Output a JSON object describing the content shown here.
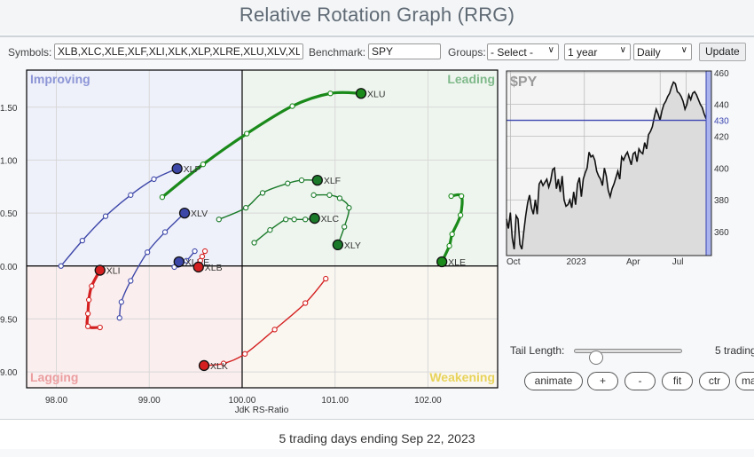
{
  "header": {
    "title": "Relative Rotation Graph (RRG)"
  },
  "toolbar": {
    "symbols_label": "Symbols:",
    "symbols_value": "XLB,XLC,XLE,XLF,XLI,XLK,XLP,XLRE,XLU,XLV,XLY",
    "benchmark_label": "Benchmark:",
    "benchmark_value": "SPY",
    "groups_label": "Groups:",
    "groups_value": "- Select -",
    "period_value": "1 year",
    "frequency_value": "Daily",
    "update_label": "Update"
  },
  "rrg": {
    "quadrants": {
      "improving": {
        "label": "Improving",
        "color": "#8d96d6",
        "bg": "#eef0fa"
      },
      "leading": {
        "label": "Leading",
        "color": "#7fb98a",
        "bg": "#eef5ee"
      },
      "lagging": {
        "label": "Lagging",
        "color": "#eb9ea0",
        "bg": "#fbeeee"
      },
      "weakening": {
        "label": "Weakening",
        "color": "#e8d35a",
        "bg": "#faf7f0"
      }
    },
    "xlabel": "JdK RS-Ratio",
    "x_ticks": [
      "98.00",
      "99.00",
      "100.00",
      "101.00",
      "102.00"
    ],
    "y_ticks_visible": [
      "1.50",
      "1.00",
      "0.50",
      "0.00",
      "9.50",
      "9.00"
    ]
  },
  "chart_data": {
    "type": "scatter",
    "title": "Relative Rotation Graph (RRG)",
    "xlabel": "JdK RS-Ratio",
    "ylabel": "JdK RS-Momentum",
    "xlim": [
      97.68,
      102.75
    ],
    "ylim": [
      98.85,
      101.85
    ],
    "center": [
      100,
      100
    ],
    "x_ticks": [
      98,
      99,
      100,
      101,
      102
    ],
    "y_ticks": [
      99.0,
      99.5,
      100.0,
      100.5,
      101.0,
      101.5
    ],
    "series": [
      {
        "name": "XLU",
        "color": "#1a8a1a",
        "quadrant": "Leading",
        "thick": true,
        "points": [
          [
            99.14,
            100.65
          ],
          [
            99.58,
            100.96
          ],
          [
            100.05,
            101.25
          ],
          [
            100.54,
            101.51
          ],
          [
            100.95,
            101.63
          ],
          [
            101.28,
            101.63
          ]
        ]
      },
      {
        "name": "XLP",
        "color": "#3d47a8",
        "quadrant": "Improving",
        "thick": false,
        "points": [
          [
            98.05,
            100.0
          ],
          [
            98.28,
            100.24
          ],
          [
            98.53,
            100.47
          ],
          [
            98.8,
            100.67
          ],
          [
            99.05,
            100.82
          ],
          [
            99.3,
            100.92
          ]
        ]
      },
      {
        "name": "XLV",
        "color": "#3d47a8",
        "quadrant": "Improving",
        "thick": false,
        "points": [
          [
            98.68,
            99.51
          ],
          [
            98.7,
            99.66
          ],
          [
            98.8,
            99.86
          ],
          [
            98.98,
            100.13
          ],
          [
            99.17,
            100.32
          ],
          [
            99.38,
            100.5
          ]
        ]
      },
      {
        "name": "XLRE",
        "color": "#3d47a8",
        "quadrant": "Improving",
        "thick": false,
        "points": [
          [
            99.49,
            100.14
          ],
          [
            99.4,
            100.05
          ],
          [
            99.31,
            100.01
          ],
          [
            99.27,
            99.99
          ],
          [
            99.32,
            100.04
          ]
        ]
      },
      {
        "name": "XLB",
        "color": "#d42020",
        "quadrant": "Lagging",
        "thick": false,
        "points": [
          [
            99.6,
            100.14
          ],
          [
            99.57,
            100.09
          ],
          [
            99.55,
            100.05
          ],
          [
            99.53,
            99.99
          ]
        ]
      },
      {
        "name": "XLI",
        "color": "#d42020",
        "quadrant": "Lagging",
        "thick": true,
        "points": [
          [
            98.47,
            99.42
          ],
          [
            98.34,
            99.43
          ],
          [
            98.34,
            99.55
          ],
          [
            98.35,
            99.68
          ],
          [
            98.38,
            99.81
          ],
          [
            98.47,
            99.96
          ]
        ]
      },
      {
        "name": "XLK",
        "color": "#d42020",
        "quadrant": "Lagging",
        "thick": false,
        "points": [
          [
            100.9,
            99.88
          ],
          [
            100.68,
            99.65
          ],
          [
            100.35,
            99.4
          ],
          [
            100.03,
            99.17
          ],
          [
            99.8,
            99.08
          ],
          [
            99.59,
            99.06
          ]
        ]
      },
      {
        "name": "XLF",
        "color": "#1a7a2a",
        "quadrant": "Leading",
        "thick": false,
        "points": [
          [
            99.75,
            100.44
          ],
          [
            100.04,
            100.55
          ],
          [
            100.22,
            100.69
          ],
          [
            100.49,
            100.78
          ],
          [
            100.64,
            100.81
          ],
          [
            100.81,
            100.81
          ]
        ]
      },
      {
        "name": "XLC",
        "color": "#1a7a2a",
        "quadrant": "Leading",
        "thick": false,
        "points": [
          [
            100.13,
            100.22
          ],
          [
            100.3,
            100.34
          ],
          [
            100.47,
            100.44
          ],
          [
            100.56,
            100.44
          ],
          [
            100.68,
            100.44
          ],
          [
            100.78,
            100.45
          ]
        ]
      },
      {
        "name": "XLY",
        "color": "#1a7a2a",
        "quadrant": "Leading",
        "thick": false,
        "points": [
          [
            100.77,
            100.67
          ],
          [
            100.94,
            100.67
          ],
          [
            101.05,
            100.64
          ],
          [
            101.15,
            100.55
          ],
          [
            101.1,
            100.37
          ],
          [
            101.03,
            100.2
          ]
        ]
      },
      {
        "name": "XLE",
        "color": "#1a8a1a",
        "quadrant": "Leading",
        "thick": true,
        "points": [
          [
            102.25,
            100.66
          ],
          [
            102.36,
            100.66
          ],
          [
            102.35,
            100.48
          ],
          [
            102.26,
            100.3
          ],
          [
            102.23,
            100.19
          ],
          [
            102.15,
            100.04
          ]
        ]
      }
    ]
  },
  "spy_chart": {
    "type": "line",
    "title": "$PY",
    "x_ticks": [
      "Oct",
      "2023",
      "Apr",
      "Jul"
    ],
    "y_ticks": [
      "460",
      "440",
      "430",
      "420",
      "400",
      "380",
      "360"
    ],
    "current_level": 430,
    "ylim": [
      345,
      461
    ],
    "values": [
      368,
      362,
      372,
      356,
      349,
      370,
      368,
      352,
      349,
      360,
      370,
      378,
      383,
      375,
      371,
      380,
      371,
      390,
      392,
      389,
      391,
      393,
      388,
      392,
      399,
      400,
      387,
      393,
      385,
      395,
      380,
      376,
      377,
      380,
      375,
      385,
      377,
      390,
      394,
      382,
      393,
      397,
      400,
      410,
      407,
      408,
      405,
      398,
      395,
      393,
      389,
      400,
      395,
      386,
      382,
      387,
      390,
      394,
      398,
      393,
      407,
      405,
      408,
      410,
      406,
      402,
      409,
      410,
      404,
      412,
      410,
      409,
      416,
      412,
      421,
      423,
      426,
      432,
      437,
      434,
      430,
      436,
      440,
      442,
      445,
      447,
      451,
      454,
      453,
      448,
      447,
      445,
      442,
      437,
      440,
      446,
      443,
      447,
      448,
      446,
      443,
      440,
      438,
      434,
      431
    ]
  },
  "controls": {
    "tail_length_label": "Tail Length:",
    "tail_length_value": "5 trading",
    "tail_length_fraction": 0.15,
    "buttons": [
      "animate",
      "+",
      "-",
      "fit",
      "ctr",
      "ma"
    ]
  },
  "footer": {
    "caption": "5 trading days ending Sep 22, 2023"
  }
}
